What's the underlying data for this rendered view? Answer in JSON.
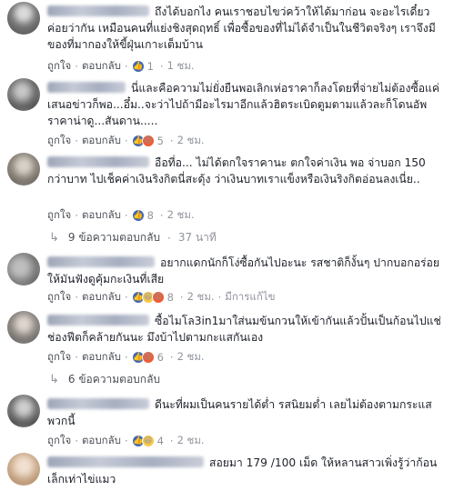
{
  "actions": {
    "like": "ถูกใจ",
    "reply": "ตอบกลับ",
    "separator": "·"
  },
  "comments": [
    {
      "text": "ถึงได้บอกไง คนเราชอบไขว่คว้าให้ได้มาก่อน จะอะไรเดี๋ยวค่อยว่ากัน เหมือนคนที่แย่งชิงสุดฤทธิ์ เพื่อซื้อของที่ไม่ได้จำเป็นในชีวิตจริงๆ เราจึงมีของที่มากองให้ขี้ฝุ่นเกาะเต็มบ้าน",
      "reaction_count": "1",
      "time": "1 ชม."
    },
    {
      "text": "นี่และคือความไม่ยั่งยืนพอเลิกเห่อราคาก็ลงโดยที่จ่ายไม่ต้องซื้อแค่เสนอข่าวก็พอ...อึ๋ม..จะว่าไปถ้ามีอะไรมาอีกแล้วฮิตระเบิดตูมตามแล้วละก็โดนอัพราคาน่าดู...สันดาน.....",
      "reaction_count": "5",
      "time": "2 ชม."
    },
    {
      "text": "อือที่อ... ไม่ได้ตกใจราคานะ ตกใจค่าเงิน พอ จ่าบอก 150 กว่าบาท ไปเช็คค่าเงินริงกิตนี่สะดุ้ง ว่าเงินบาทเราแข็งหรือเงินริงกิตอ่อนลงเนี่ย..",
      "reaction_count": "8",
      "time": "2 ชม."
    },
    {
      "text": "อยากแดกนักก็โง่ซื้อกันไปอะนะ รสชาติก็งั้นๆ ปากบอกอร่อยให้มันฟังดูคุ้มกะเงินที่เสีย",
      "reaction_count": "8",
      "time": "2 ชม.",
      "edited": "มีการแก้ไข"
    },
    {
      "text": "ซื้อไมโล3in1มาใส่นมข้นกวนให้เข้ากันแล้วปั้นเป็นก้อนไปแช่ช่องฟีตก็คล้ายกันนะ มึงบ้าไปตามกะแสกันเอง",
      "reaction_count": "6",
      "time": "2 ชม."
    },
    {
      "text": "ดีนะที่ผมเป็นคนรายได้ต่ำ รสนิยมต่ำ เลยไม่ต้องตามกระแสพวกนี้",
      "reaction_count": "4",
      "time": "2 ชม."
    },
    {
      "text": "สอยมา 179 /100 เม็ด ให้หลานสาวเพิ่งรู้ว่าก้อนเล็กเท่าไข่แมว"
    }
  ],
  "replies": [
    {
      "label": "9 ข้อความตอบกลับ",
      "time": "37 นาที"
    },
    {
      "label": "6 ข้อความตอบกลับ"
    }
  ],
  "icons": {
    "like": "like-icon",
    "angry": "angry-icon",
    "haha": "haha-icon",
    "reply_arrow": "reply-arrow-icon"
  },
  "colors": {
    "link": "#4b4f56",
    "meta": "#90949c",
    "like": "#4267b2",
    "text": "#1d2129"
  }
}
